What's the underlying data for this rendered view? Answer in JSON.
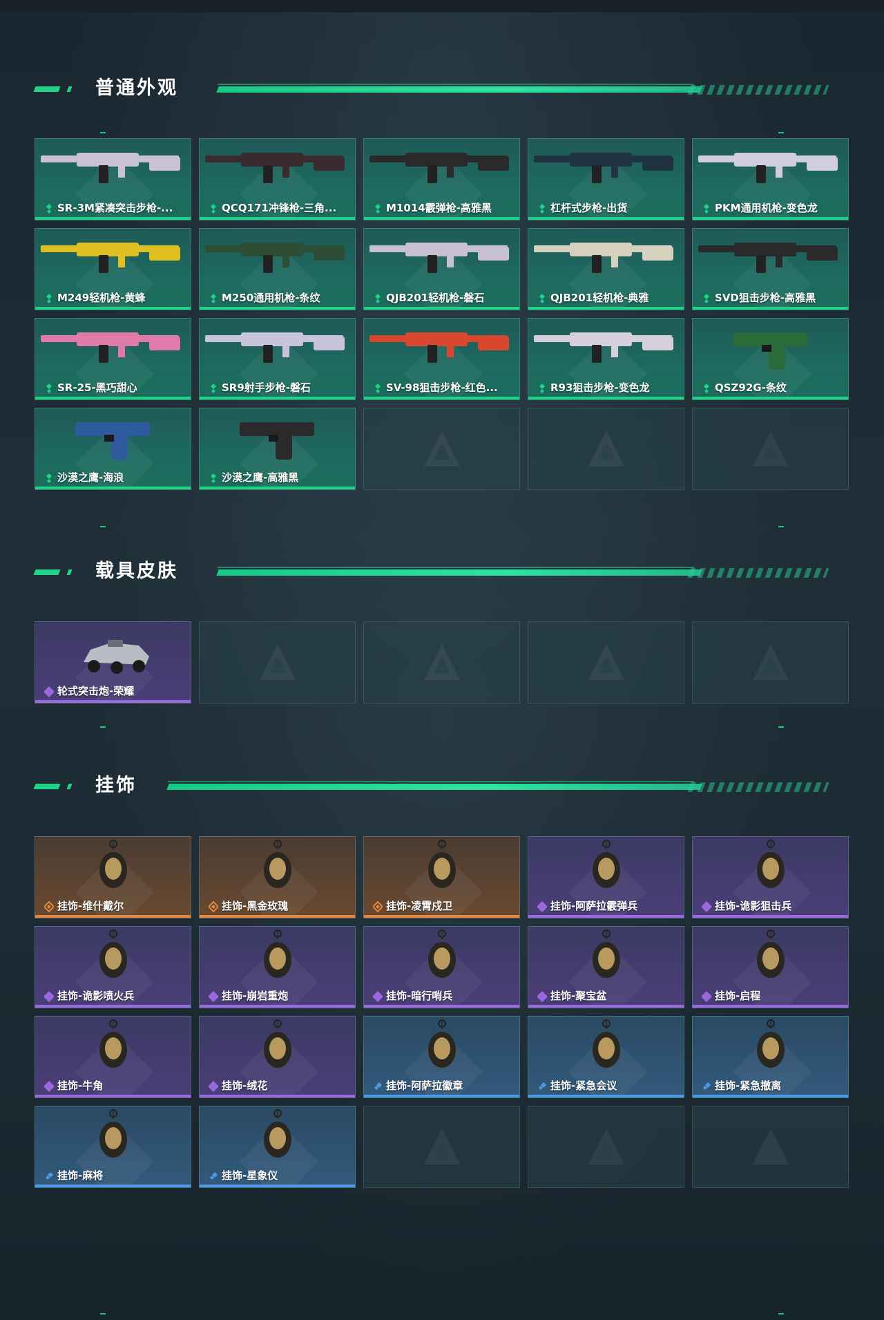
{
  "sections": {
    "weapon": {
      "title": "普通外观",
      "items": [
        {
          "label": "SR-3M紧凑突击步枪-...",
          "icon": "smg-rifle-icon"
        },
        {
          "label": "QCQ171冲锋枪-三角...",
          "icon": "smg-icon"
        },
        {
          "label": "M1014霰弹枪-高雅黑",
          "icon": "shotgun-icon"
        },
        {
          "label": "杠杆式步枪-出货",
          "icon": "lever-rifle-icon"
        },
        {
          "label": "PKM通用机枪-变色龙",
          "icon": "machine-gun-icon"
        },
        {
          "label": "M249轻机枪-黄蜂",
          "icon": "lmg-icon"
        },
        {
          "label": "M250通用机枪-条纹",
          "icon": "lmg-icon"
        },
        {
          "label": "QJB201轻机枪-磐石",
          "icon": "lmg-icon"
        },
        {
          "label": "QJB201轻机枪-典雅",
          "icon": "lmg-icon"
        },
        {
          "label": "SVD狙击步枪-高雅黑",
          "icon": "sniper-rifle-icon"
        },
        {
          "label": "SR-25-黑巧甜心",
          "icon": "rifle-icon"
        },
        {
          "label": "SR9射手步枪-磐石",
          "icon": "rifle-icon"
        },
        {
          "label": "SV-98狙击步枪-红色...",
          "icon": "sniper-rifle-icon"
        },
        {
          "label": "R93狙击步枪-变色龙",
          "icon": "sniper-rifle-icon"
        },
        {
          "label": "QSZ92G-条纹",
          "icon": "pistol-icon"
        },
        {
          "label": "沙漠之鹰-海浪",
          "icon": "pistol-icon"
        },
        {
          "label": "沙漠之鹰-高雅黑",
          "icon": "pistol-icon"
        }
      ]
    },
    "vehicle": {
      "title": "载具皮肤",
      "items": [
        {
          "label": "轮式突击炮-荣耀",
          "icon": "vehicle-icon"
        }
      ]
    },
    "charm": {
      "title": "挂饰",
      "items": [
        {
          "label": "挂饰-维什戴尔",
          "rarity": "orange",
          "icon": "charm-icon"
        },
        {
          "label": "挂饰-黑金玫瑰",
          "rarity": "orange",
          "icon": "charm-icon"
        },
        {
          "label": "挂饰-凌霄戍卫",
          "rarity": "orange",
          "icon": "charm-icon"
        },
        {
          "label": "挂饰-阿萨拉霰弹兵",
          "rarity": "purple",
          "icon": "charm-icon"
        },
        {
          "label": "挂饰-诡影狙击兵",
          "rarity": "purple",
          "icon": "charm-icon"
        },
        {
          "label": "挂饰-诡影喷火兵",
          "rarity": "purple",
          "icon": "charm-icon"
        },
        {
          "label": "挂饰-崩岩重炮",
          "rarity": "purple",
          "icon": "charm-icon"
        },
        {
          "label": "挂饰-暗行哨兵",
          "rarity": "purple",
          "icon": "charm-icon"
        },
        {
          "label": "挂饰-聚宝盆",
          "rarity": "purple",
          "icon": "charm-icon"
        },
        {
          "label": "挂饰-启程",
          "rarity": "purple",
          "icon": "charm-icon"
        },
        {
          "label": "挂饰-牛角",
          "rarity": "purple",
          "icon": "charm-icon"
        },
        {
          "label": "挂饰-绒花",
          "rarity": "purple",
          "icon": "charm-icon"
        },
        {
          "label": "挂饰-阿萨拉徽章",
          "rarity": "blue",
          "icon": "charm-icon"
        },
        {
          "label": "挂饰-紧急会议",
          "rarity": "blue",
          "icon": "charm-icon"
        },
        {
          "label": "挂饰-紧急撤离",
          "rarity": "blue",
          "icon": "charm-icon"
        },
        {
          "label": "挂饰-麻将",
          "rarity": "blue",
          "icon": "charm-icon"
        },
        {
          "label": "挂饰-星象仪",
          "rarity": "blue",
          "icon": "charm-icon"
        }
      ]
    }
  },
  "colors": {
    "accent": "#21d387",
    "green": "#21d387",
    "purple": "#9b6ae0",
    "orange": "#e28841",
    "blue": "#4c9be3"
  }
}
